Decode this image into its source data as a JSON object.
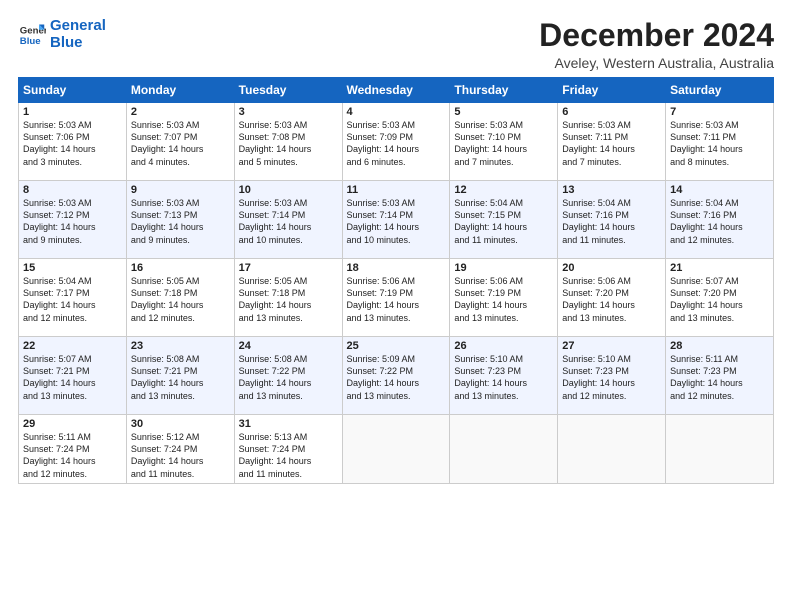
{
  "logo": {
    "line1": "General",
    "line2": "Blue"
  },
  "title": "December 2024",
  "subtitle": "Aveley, Western Australia, Australia",
  "headers": [
    "Sunday",
    "Monday",
    "Tuesday",
    "Wednesday",
    "Thursday",
    "Friday",
    "Saturday"
  ],
  "weeks": [
    [
      {
        "day": "1",
        "lines": [
          "Sunrise: 5:03 AM",
          "Sunset: 7:06 PM",
          "Daylight: 14 hours",
          "and 3 minutes."
        ]
      },
      {
        "day": "2",
        "lines": [
          "Sunrise: 5:03 AM",
          "Sunset: 7:07 PM",
          "Daylight: 14 hours",
          "and 4 minutes."
        ]
      },
      {
        "day": "3",
        "lines": [
          "Sunrise: 5:03 AM",
          "Sunset: 7:08 PM",
          "Daylight: 14 hours",
          "and 5 minutes."
        ]
      },
      {
        "day": "4",
        "lines": [
          "Sunrise: 5:03 AM",
          "Sunset: 7:09 PM",
          "Daylight: 14 hours",
          "and 6 minutes."
        ]
      },
      {
        "day": "5",
        "lines": [
          "Sunrise: 5:03 AM",
          "Sunset: 7:10 PM",
          "Daylight: 14 hours",
          "and 7 minutes."
        ]
      },
      {
        "day": "6",
        "lines": [
          "Sunrise: 5:03 AM",
          "Sunset: 7:11 PM",
          "Daylight: 14 hours",
          "and 7 minutes."
        ]
      },
      {
        "day": "7",
        "lines": [
          "Sunrise: 5:03 AM",
          "Sunset: 7:11 PM",
          "Daylight: 14 hours",
          "and 8 minutes."
        ]
      }
    ],
    [
      {
        "day": "8",
        "lines": [
          "Sunrise: 5:03 AM",
          "Sunset: 7:12 PM",
          "Daylight: 14 hours",
          "and 9 minutes."
        ]
      },
      {
        "day": "9",
        "lines": [
          "Sunrise: 5:03 AM",
          "Sunset: 7:13 PM",
          "Daylight: 14 hours",
          "and 9 minutes."
        ]
      },
      {
        "day": "10",
        "lines": [
          "Sunrise: 5:03 AM",
          "Sunset: 7:14 PM",
          "Daylight: 14 hours",
          "and 10 minutes."
        ]
      },
      {
        "day": "11",
        "lines": [
          "Sunrise: 5:03 AM",
          "Sunset: 7:14 PM",
          "Daylight: 14 hours",
          "and 10 minutes."
        ]
      },
      {
        "day": "12",
        "lines": [
          "Sunrise: 5:04 AM",
          "Sunset: 7:15 PM",
          "Daylight: 14 hours",
          "and 11 minutes."
        ]
      },
      {
        "day": "13",
        "lines": [
          "Sunrise: 5:04 AM",
          "Sunset: 7:16 PM",
          "Daylight: 14 hours",
          "and 11 minutes."
        ]
      },
      {
        "day": "14",
        "lines": [
          "Sunrise: 5:04 AM",
          "Sunset: 7:16 PM",
          "Daylight: 14 hours",
          "and 12 minutes."
        ]
      }
    ],
    [
      {
        "day": "15",
        "lines": [
          "Sunrise: 5:04 AM",
          "Sunset: 7:17 PM",
          "Daylight: 14 hours",
          "and 12 minutes."
        ]
      },
      {
        "day": "16",
        "lines": [
          "Sunrise: 5:05 AM",
          "Sunset: 7:18 PM",
          "Daylight: 14 hours",
          "and 12 minutes."
        ]
      },
      {
        "day": "17",
        "lines": [
          "Sunrise: 5:05 AM",
          "Sunset: 7:18 PM",
          "Daylight: 14 hours",
          "and 13 minutes."
        ]
      },
      {
        "day": "18",
        "lines": [
          "Sunrise: 5:06 AM",
          "Sunset: 7:19 PM",
          "Daylight: 14 hours",
          "and 13 minutes."
        ]
      },
      {
        "day": "19",
        "lines": [
          "Sunrise: 5:06 AM",
          "Sunset: 7:19 PM",
          "Daylight: 14 hours",
          "and 13 minutes."
        ]
      },
      {
        "day": "20",
        "lines": [
          "Sunrise: 5:06 AM",
          "Sunset: 7:20 PM",
          "Daylight: 14 hours",
          "and 13 minutes."
        ]
      },
      {
        "day": "21",
        "lines": [
          "Sunrise: 5:07 AM",
          "Sunset: 7:20 PM",
          "Daylight: 14 hours",
          "and 13 minutes."
        ]
      }
    ],
    [
      {
        "day": "22",
        "lines": [
          "Sunrise: 5:07 AM",
          "Sunset: 7:21 PM",
          "Daylight: 14 hours",
          "and 13 minutes."
        ]
      },
      {
        "day": "23",
        "lines": [
          "Sunrise: 5:08 AM",
          "Sunset: 7:21 PM",
          "Daylight: 14 hours",
          "and 13 minutes."
        ]
      },
      {
        "day": "24",
        "lines": [
          "Sunrise: 5:08 AM",
          "Sunset: 7:22 PM",
          "Daylight: 14 hours",
          "and 13 minutes."
        ]
      },
      {
        "day": "25",
        "lines": [
          "Sunrise: 5:09 AM",
          "Sunset: 7:22 PM",
          "Daylight: 14 hours",
          "and 13 minutes."
        ]
      },
      {
        "day": "26",
        "lines": [
          "Sunrise: 5:10 AM",
          "Sunset: 7:23 PM",
          "Daylight: 14 hours",
          "and 13 minutes."
        ]
      },
      {
        "day": "27",
        "lines": [
          "Sunrise: 5:10 AM",
          "Sunset: 7:23 PM",
          "Daylight: 14 hours",
          "and 12 minutes."
        ]
      },
      {
        "day": "28",
        "lines": [
          "Sunrise: 5:11 AM",
          "Sunset: 7:23 PM",
          "Daylight: 14 hours",
          "and 12 minutes."
        ]
      }
    ],
    [
      {
        "day": "29",
        "lines": [
          "Sunrise: 5:11 AM",
          "Sunset: 7:24 PM",
          "Daylight: 14 hours",
          "and 12 minutes."
        ]
      },
      {
        "day": "30",
        "lines": [
          "Sunrise: 5:12 AM",
          "Sunset: 7:24 PM",
          "Daylight: 14 hours",
          "and 11 minutes."
        ]
      },
      {
        "day": "31",
        "lines": [
          "Sunrise: 5:13 AM",
          "Sunset: 7:24 PM",
          "Daylight: 14 hours",
          "and 11 minutes."
        ]
      },
      null,
      null,
      null,
      null
    ]
  ]
}
